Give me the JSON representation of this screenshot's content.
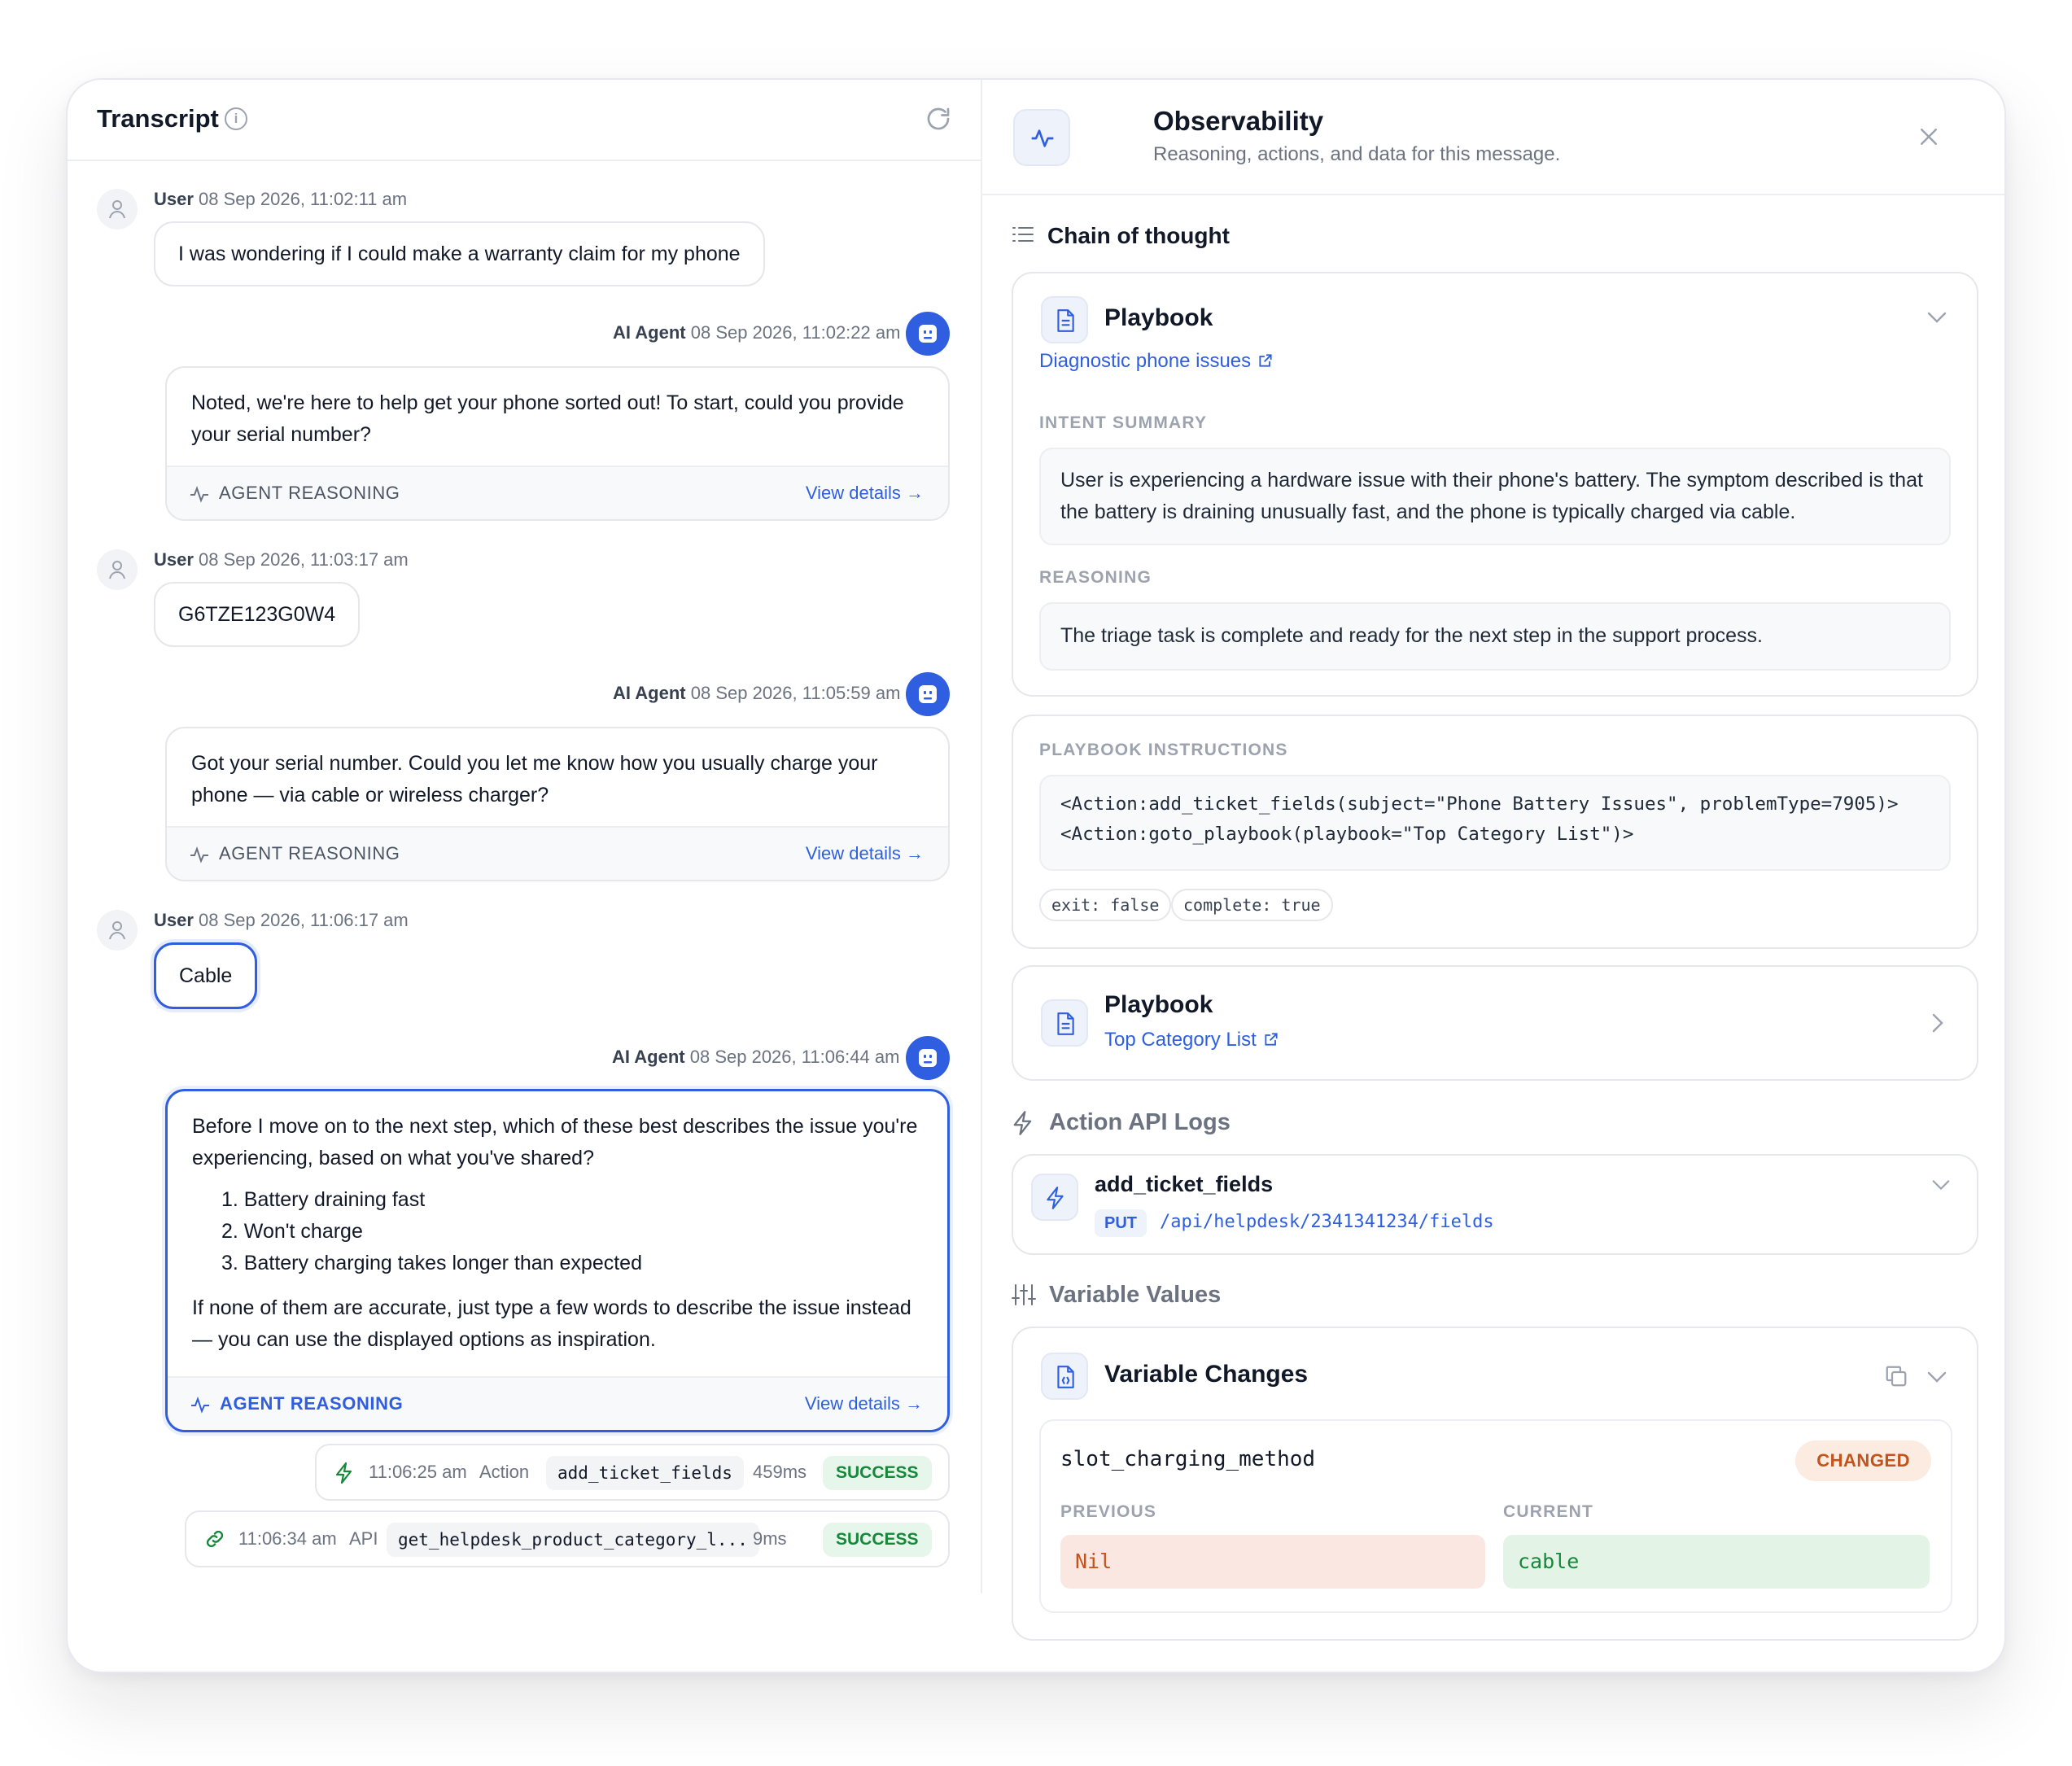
{
  "transcript": {
    "title": "Transcript",
    "messages": [
      {
        "role": "User",
        "time": "08 Sep 2026, 11:02:11 am",
        "text": "I was wondering if I could make a warranty claim for my phone"
      },
      {
        "role": "AI Agent",
        "time": "08 Sep 2026, 11:02:22 am",
        "text": "Noted, we're here to help get your phone sorted out! To start, could you provide your serial number?",
        "reasoning_label": "AGENT REASONING",
        "view_label": "View details →"
      },
      {
        "role": "User",
        "time": "08 Sep 2026, 11:03:17 am",
        "text": "G6TZE123G0W4"
      },
      {
        "role": "AI Agent",
        "time": "08 Sep 2026, 11:05:59 am",
        "text": "Got your serial number. Could you let me know how you usually charge your phone — via cable or wireless charger?",
        "reasoning_label": "AGENT REASONING",
        "view_label": "View details →"
      },
      {
        "role": "User",
        "time": "08 Sep 2026, 11:06:17 am",
        "text": "Cable"
      },
      {
        "role": "AI Agent",
        "time": "08 Sep 2026, 11:06:44 am",
        "text": "Before I move on to the next step, which of these best describes the issue you're experiencing, based on what you've shared?",
        "options": [
          "1. Battery draining fast",
          "2. Won't charge",
          "3. Battery charging takes longer than expected"
        ],
        "footer_text": "If none of them are accurate, just type a few words to describe the issue instead — you can use the displayed options as inspiration.",
        "reasoning_label": "AGENT REASONING",
        "view_label": "View details →"
      }
    ],
    "logs": [
      {
        "time": "11:06:25 am",
        "kind": "Action",
        "name": "add_ticket_fields",
        "duration": "459ms",
        "status": "SUCCESS"
      },
      {
        "time": "11:06:34 am",
        "kind": "API",
        "name": "get_helpdesk_product_category_l...",
        "duration": "9ms",
        "status": "SUCCESS"
      }
    ]
  },
  "observability": {
    "title": "Observability",
    "subtitle": "Reasoning, actions, and data for this message.",
    "chain_title": "Chain of thought",
    "playbook1": {
      "label": "Playbook",
      "link": "Diagnostic phone issues",
      "intent_caption": "INTENT SUMMARY",
      "intent_text": "User is experiencing a hardware issue with their phone's battery. The symptom described is that the battery is draining unusually fast, and the phone is typically charged via cable.",
      "reasoning_caption": "REASONING",
      "reasoning_text": "The triage task is complete and ready for the next step in the support process."
    },
    "instructions": {
      "caption": "PLAYBOOK INSTRUCTIONS",
      "line1": "<Action:add_ticket_fields(subject=\"Phone Battery Issues\", problemType=7905)>",
      "line2": "<Action:goto_playbook(playbook=\"Top Category List\")>",
      "pills": [
        "exit: false",
        "complete: true"
      ]
    },
    "playbook2": {
      "label": "Playbook",
      "link": "Top Category List"
    },
    "action_logs": {
      "title": "Action API Logs",
      "name": "add_ticket_fields",
      "method": "PUT",
      "path": "/api/helpdesk/2341341234/fields"
    },
    "variables": {
      "title": "Variable Values",
      "card_title": "Variable Changes",
      "name": "slot_charging_method",
      "badge": "CHANGED",
      "previous_caption": "PREVIOUS",
      "current_caption": "CURRENT",
      "previous": "Nil",
      "current": "cable"
    }
  },
  "colors": {
    "accent": "#2f5fe0",
    "success": "#16883a",
    "changed": "#c2531c"
  }
}
